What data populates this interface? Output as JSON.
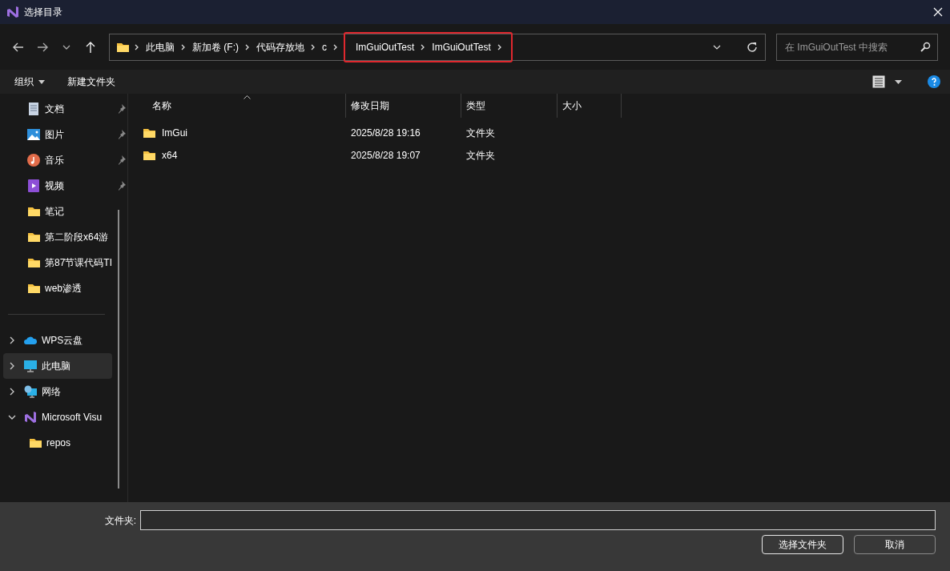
{
  "window": {
    "title": "选择目录"
  },
  "address": {
    "segments": [
      "此电脑",
      "新加卷 (F:)",
      "代码存放地",
      "c"
    ],
    "highlighted_segments": [
      "ImGuiOutTest",
      "ImGuiOutTest"
    ]
  },
  "search": {
    "placeholder": "在 ImGuiOutTest 中搜索"
  },
  "toolbar": {
    "organize": "组织",
    "new_folder": "新建文件夹"
  },
  "quick_access": [
    {
      "label": "文档",
      "kind": "document",
      "pinned": true
    },
    {
      "label": "图片",
      "kind": "picture",
      "pinned": true
    },
    {
      "label": "音乐",
      "kind": "music",
      "pinned": true
    },
    {
      "label": "视频",
      "kind": "video",
      "pinned": true
    },
    {
      "label": "笔记",
      "kind": "folder",
      "pinned": false
    },
    {
      "label": "第二阶段x64游",
      "kind": "folder",
      "pinned": false
    },
    {
      "label": "第87节课代码TI",
      "kind": "folder",
      "pinned": false
    },
    {
      "label": "web渗透",
      "kind": "folder",
      "pinned": false
    }
  ],
  "tree": [
    {
      "label": "WPS云盘",
      "kind": "cloud",
      "expanded": false,
      "selected": false
    },
    {
      "label": "此电脑",
      "kind": "computer",
      "expanded": false,
      "selected": true
    },
    {
      "label": "网络",
      "kind": "network",
      "expanded": false,
      "selected": false
    },
    {
      "label": "Microsoft Visu",
      "kind": "vs",
      "expanded": true,
      "selected": false,
      "children": [
        {
          "label": "repos",
          "kind": "folder"
        }
      ]
    }
  ],
  "columns": [
    {
      "label": "名称",
      "sorted": true
    },
    {
      "label": "修改日期",
      "sorted": false
    },
    {
      "label": "类型",
      "sorted": false
    },
    {
      "label": "大小",
      "sorted": false
    }
  ],
  "rows": [
    {
      "name": "ImGui",
      "modified": "2025/8/28 19:16",
      "type": "文件夹"
    },
    {
      "name": "x64",
      "modified": "2025/8/28 19:07",
      "type": "文件夹"
    }
  ],
  "footer": {
    "folder_label": "文件夹:",
    "buttons": [
      {
        "label": "选择文件夹",
        "default": true
      },
      {
        "label": "取消",
        "default": false
      }
    ]
  }
}
